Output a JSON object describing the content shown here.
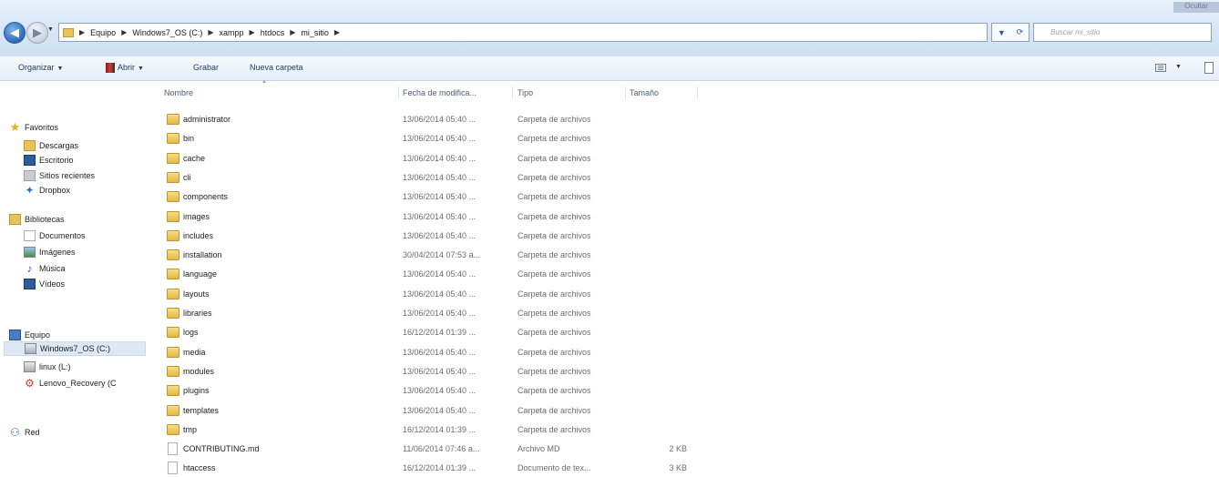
{
  "window": {
    "corner_label": "Ocultar"
  },
  "address": {
    "crumbs": [
      "Equipo",
      "Windows7_OS (C:)",
      "xampp",
      "htdocs",
      "mi_sitio"
    ],
    "search_placeholder": "Buscar mi_sitio"
  },
  "toolbar": {
    "organize": "Organizar",
    "open": "Abrir",
    "burn": "Grabar",
    "new_folder": "Nueva carpeta"
  },
  "nav": {
    "favorites": {
      "label": "Favoritos",
      "items": [
        "Descargas",
        "Escritorio",
        "Sitios recientes",
        "Dropbox"
      ]
    },
    "libraries": {
      "label": "Bibliotecas",
      "items": [
        "Documentos",
        "Imágenes",
        "Música",
        "Vídeos"
      ]
    },
    "computer": {
      "label": "Equipo",
      "items": [
        "Windows7_OS (C:)",
        "linux (L:)",
        "Lenovo_Recovery (C"
      ]
    },
    "network": {
      "label": "Red"
    }
  },
  "columns": {
    "name": "Nombre",
    "date": "Fecha de modifica...",
    "type": "Tipo",
    "size": "Tamaño"
  },
  "rows": [
    {
      "name": "administrator",
      "date": "13/06/2014 05:40 ...",
      "type": "Carpeta de archivos",
      "size": ""
    },
    {
      "name": "bin",
      "date": "13/06/2014 05:40 ...",
      "type": "Carpeta de archivos",
      "size": ""
    },
    {
      "name": "cache",
      "date": "13/06/2014 05:40 ...",
      "type": "Carpeta de archivos",
      "size": ""
    },
    {
      "name": "cli",
      "date": "13/06/2014 05:40 ...",
      "type": "Carpeta de archivos",
      "size": ""
    },
    {
      "name": "components",
      "date": "13/06/2014 05:40 ...",
      "type": "Carpeta de archivos",
      "size": ""
    },
    {
      "name": "images",
      "date": "13/06/2014 05:40 ...",
      "type": "Carpeta de archivos",
      "size": ""
    },
    {
      "name": "includes",
      "date": "13/06/2014 05:40 ...",
      "type": "Carpeta de archivos",
      "size": ""
    },
    {
      "name": "installation",
      "date": "30/04/2014 07:53 a...",
      "type": "Carpeta de archivos",
      "size": ""
    },
    {
      "name": "language",
      "date": "13/06/2014 05:40 ...",
      "type": "Carpeta de archivos",
      "size": ""
    },
    {
      "name": "layouts",
      "date": "13/06/2014 05:40 ...",
      "type": "Carpeta de archivos",
      "size": ""
    },
    {
      "name": "libraries",
      "date": "13/06/2014 05:40 ...",
      "type": "Carpeta de archivos",
      "size": ""
    },
    {
      "name": "logs",
      "date": "16/12/2014 01:39 ...",
      "type": "Carpeta de archivos",
      "size": ""
    },
    {
      "name": "media",
      "date": "13/06/2014 05:40 ...",
      "type": "Carpeta de archivos",
      "size": ""
    },
    {
      "name": "modules",
      "date": "13/06/2014 05:40 ...",
      "type": "Carpeta de archivos",
      "size": ""
    },
    {
      "name": "plugins",
      "date": "13/06/2014 05:40 ...",
      "type": "Carpeta de archivos",
      "size": ""
    },
    {
      "name": "templates",
      "date": "13/06/2014 05:40 ...",
      "type": "Carpeta de archivos",
      "size": ""
    },
    {
      "name": "tmp",
      "date": "16/12/2014 01:39 ...",
      "type": "Carpeta de archivos",
      "size": ""
    },
    {
      "name": "CONTRIBUTING.md",
      "date": "11/06/2014 07:46 a...",
      "type": "Archivo MD",
      "size": "2 KB"
    },
    {
      "name": "htaccess",
      "date": "16/12/2014 01:39 ...",
      "type": "Documento de tex...",
      "size": "3 KB"
    }
  ]
}
